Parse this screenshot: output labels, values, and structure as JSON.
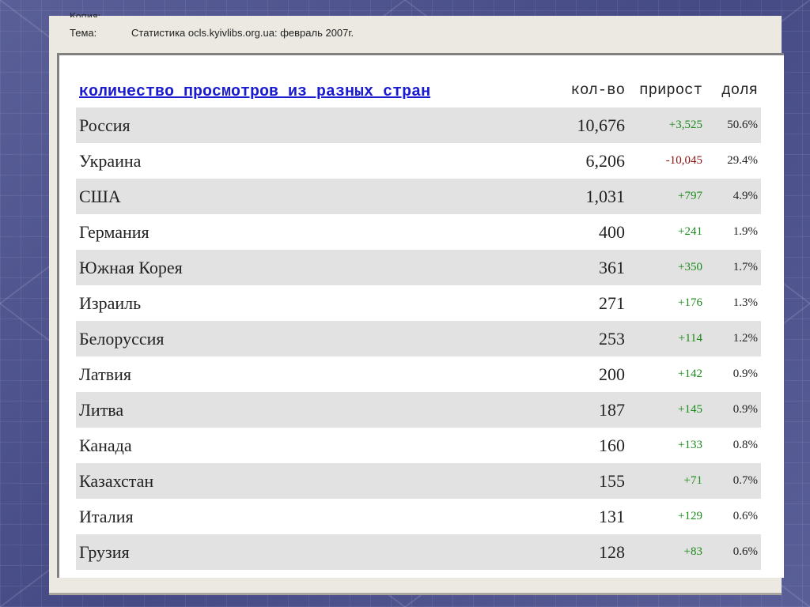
{
  "header": {
    "cut_text": "Копия:",
    "subject_label": "Тема:",
    "subject_value": "Статистика ocls.kyivlibs.org.ua: февраль 2007г."
  },
  "table": {
    "title_link": "количество просмотров из разных стран",
    "col_count": "кол-во",
    "col_growth": "прирост",
    "col_share": "доля",
    "rows": [
      {
        "country": "Россия",
        "count": "10,676",
        "growth": "+3,525",
        "share": "50.6%",
        "growth_sign": "pos"
      },
      {
        "country": "Украина",
        "count": "6,206",
        "growth": "-10,045",
        "share": "29.4%",
        "growth_sign": "neg"
      },
      {
        "country": "США",
        "count": "1,031",
        "growth": "+797",
        "share": "4.9%",
        "growth_sign": "pos"
      },
      {
        "country": "Германия",
        "count": "400",
        "growth": "+241",
        "share": "1.9%",
        "growth_sign": "pos"
      },
      {
        "country": "Южная Корея",
        "count": "361",
        "growth": "+350",
        "share": "1.7%",
        "growth_sign": "pos"
      },
      {
        "country": "Израиль",
        "count": "271",
        "growth": "+176",
        "share": "1.3%",
        "growth_sign": "pos"
      },
      {
        "country": "Белоруссия",
        "count": "253",
        "growth": "+114",
        "share": "1.2%",
        "growth_sign": "pos"
      },
      {
        "country": "Латвия",
        "count": "200",
        "growth": "+142",
        "share": "0.9%",
        "growth_sign": "pos"
      },
      {
        "country": "Литва",
        "count": "187",
        "growth": "+145",
        "share": "0.9%",
        "growth_sign": "pos"
      },
      {
        "country": "Канада",
        "count": "160",
        "growth": "+133",
        "share": "0.8%",
        "growth_sign": "pos"
      },
      {
        "country": "Казахстан",
        "count": "155",
        "growth": "+71",
        "share": "0.7%",
        "growth_sign": "pos"
      },
      {
        "country": "Италия",
        "count": "131",
        "growth": "+129",
        "share": "0.6%",
        "growth_sign": "pos"
      },
      {
        "country": "Грузия",
        "count": "128",
        "growth": "+83",
        "share": "0.6%",
        "growth_sign": "pos"
      }
    ]
  },
  "colors": {
    "background": "#4a4f8a",
    "link": "#1a1ad0",
    "positive": "#1a8a1a",
    "negative": "#8a1010",
    "row_shade": "#e2e2e2"
  }
}
